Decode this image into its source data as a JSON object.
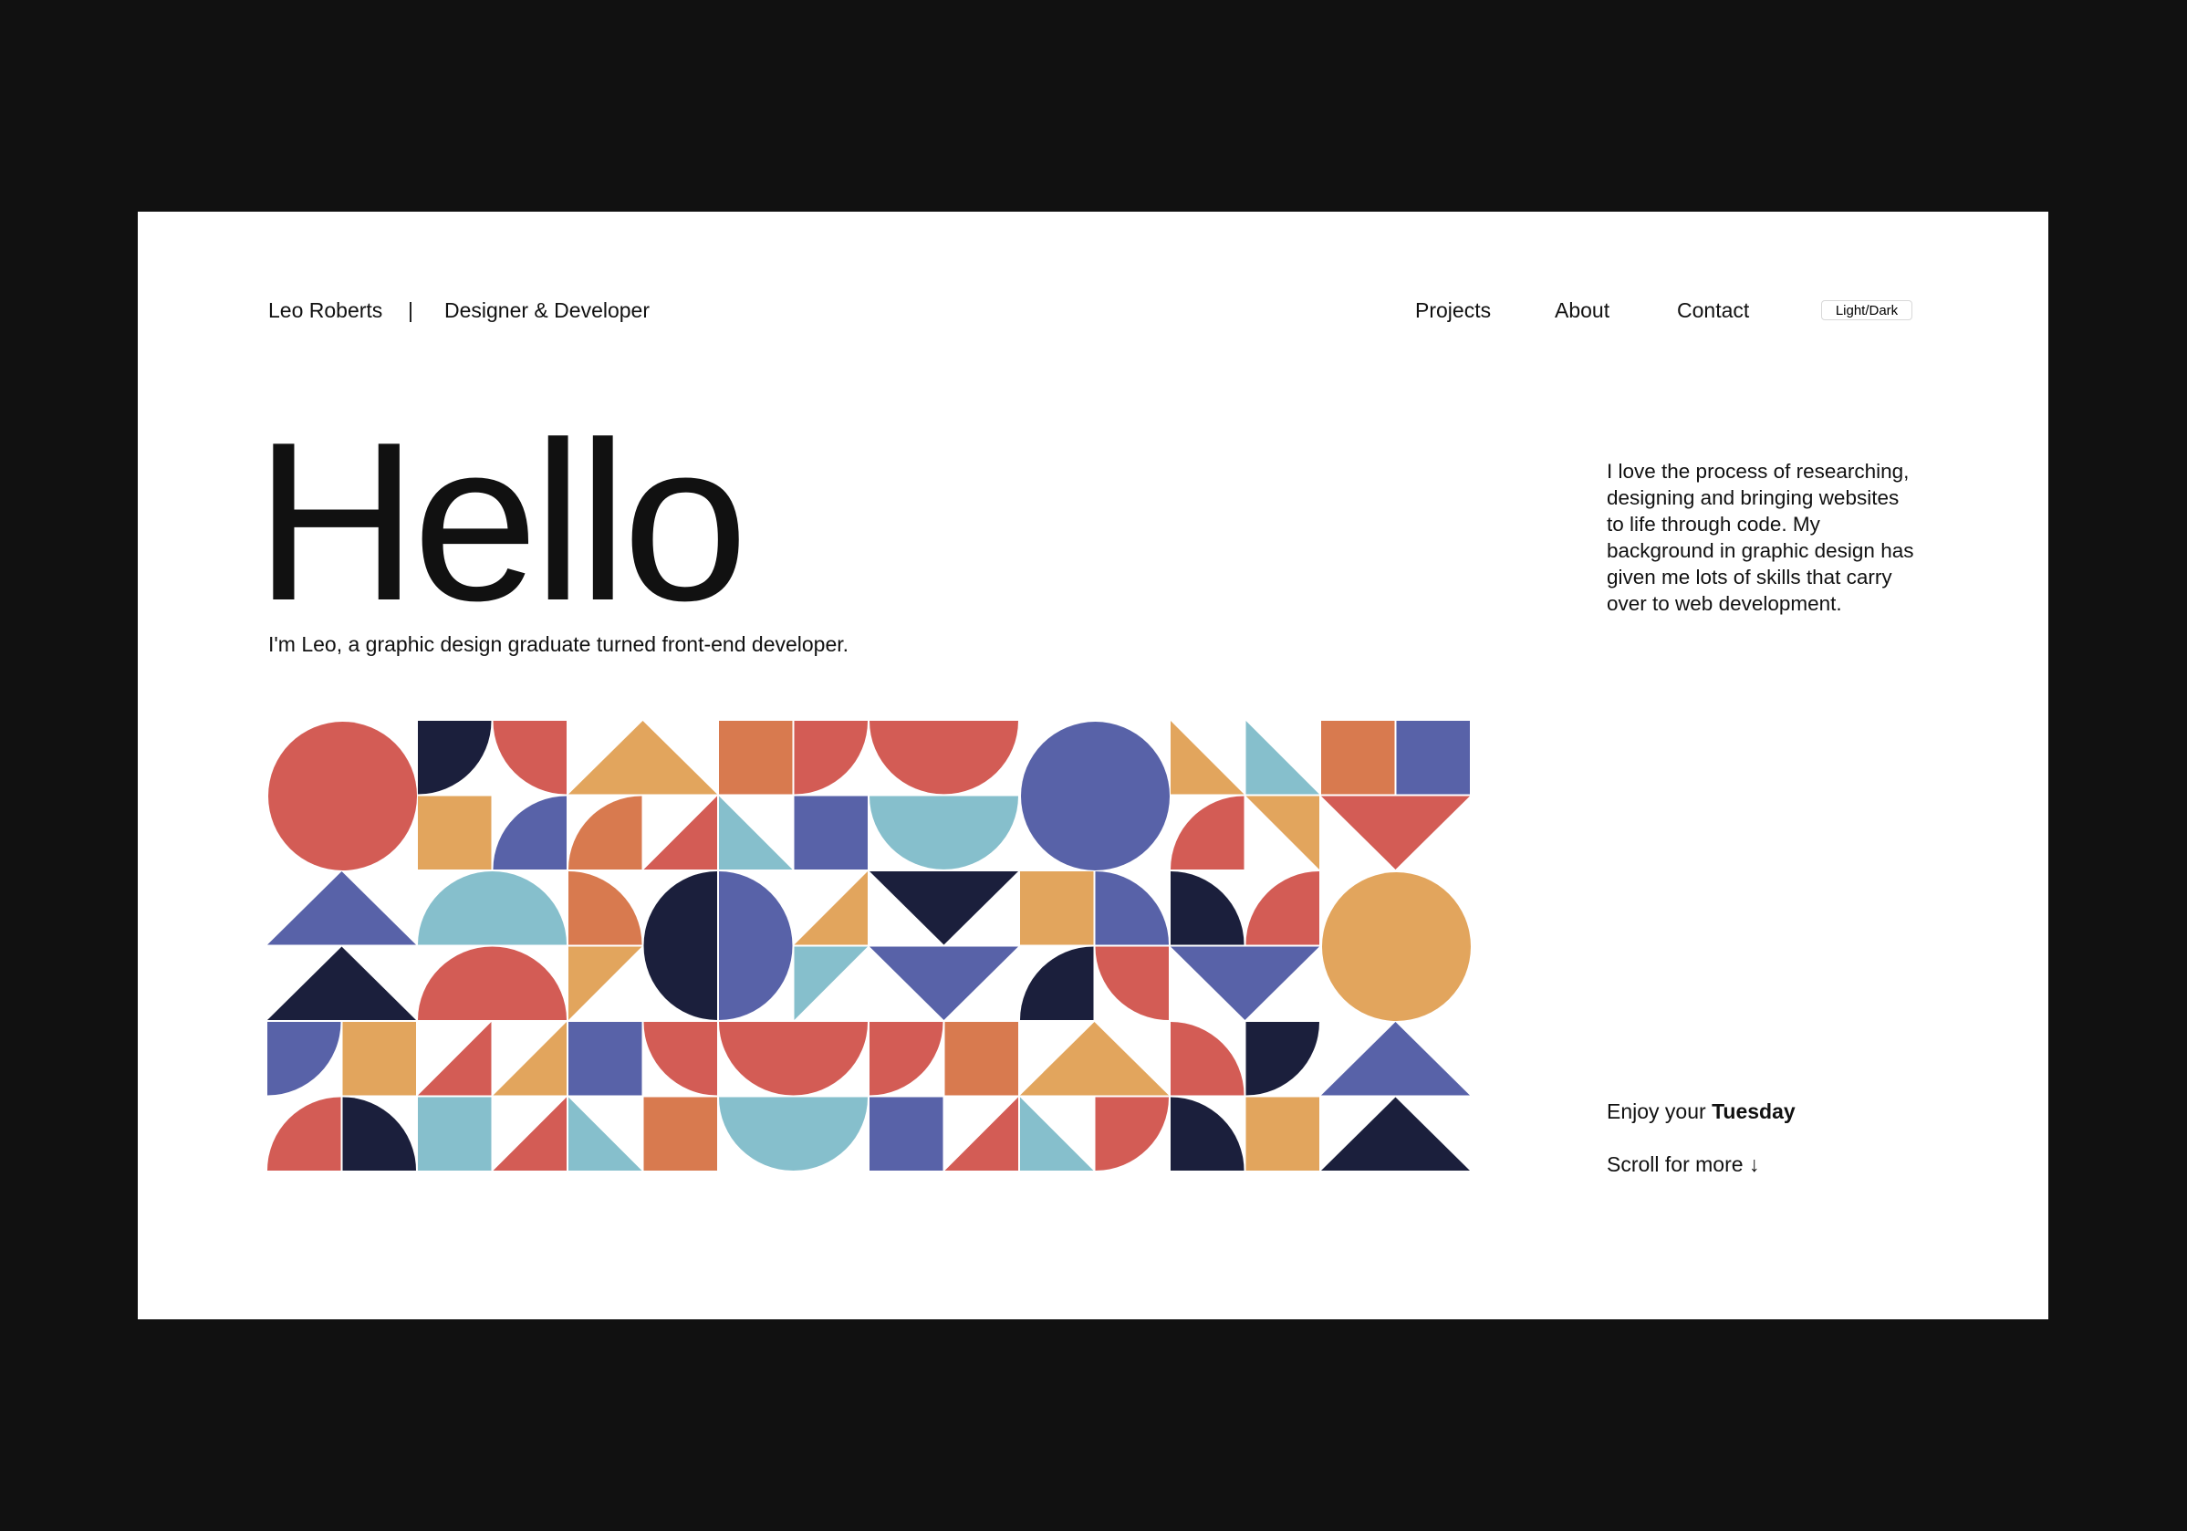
{
  "header": {
    "name": "Leo Roberts",
    "separator": "|",
    "role": "Designer & Developer",
    "nav": [
      "Projects",
      "About",
      "Contact"
    ],
    "theme_toggle": "Light/Dark"
  },
  "hero": {
    "title": "Hello",
    "subtitle": "I'm Leo, a graphic design graduate turned front-end developer."
  },
  "intro": "I love the process of researching, designing and bringing websites to life through code. My background in graphic design has given me lots of skills that carry over to web development.",
  "greeting": {
    "prefix": "Enjoy your",
    "day": "Tuesday"
  },
  "scroll": "Scroll for more ↓",
  "colors": {
    "background": "#111111",
    "page": "#ffffff",
    "red": "#d35c55",
    "orange": "#d87a4f",
    "yellow": "#e2a55d",
    "blue": "#5862a8",
    "teal": "#86bfcc",
    "navy": "#1b1f3c"
  },
  "pattern": {
    "shapes": [
      {
        "t": "circle",
        "c": 0,
        "r": 0,
        "s": 2,
        "fill": "red"
      },
      {
        "t": "q",
        "c": 2,
        "r": 0,
        "o": "tl",
        "fill": "navy"
      },
      {
        "t": "q",
        "c": 3,
        "r": 0,
        "o": "tr",
        "fill": "red"
      },
      {
        "t": "tri",
        "c": 4,
        "r": 0,
        "w": 2,
        "o": "up",
        "fill": "yellow"
      },
      {
        "t": "sq",
        "c": 6,
        "r": 0,
        "fill": "orange"
      },
      {
        "t": "q",
        "c": 7,
        "r": 0,
        "o": "tl",
        "fill": "red"
      },
      {
        "t": "semi",
        "c": 8,
        "r": 0,
        "o": "down",
        "fill": "red"
      },
      {
        "t": "circle",
        "c": 10,
        "r": 0,
        "s": 2,
        "fill": "blue"
      },
      {
        "t": "rt",
        "c": 12,
        "r": 0,
        "o": "bl",
        "fill": "yellow"
      },
      {
        "t": "rt",
        "c": 13,
        "r": 0,
        "o": "bl",
        "fill": "teal"
      },
      {
        "t": "sq",
        "c": 14,
        "r": 0,
        "fill": "orange"
      },
      {
        "t": "sq",
        "c": 15,
        "r": 0,
        "fill": "blue"
      },
      {
        "t": "sq",
        "c": 2,
        "r": 1,
        "fill": "yellow"
      },
      {
        "t": "q",
        "c": 3,
        "r": 1,
        "o": "br",
        "fill": "blue"
      },
      {
        "t": "q",
        "c": 4,
        "r": 1,
        "o": "br",
        "fill": "orange"
      },
      {
        "t": "rt",
        "c": 5,
        "r": 1,
        "o": "br",
        "fill": "red"
      },
      {
        "t": "rt",
        "c": 6,
        "r": 1,
        "o": "bl",
        "fill": "teal"
      },
      {
        "t": "sq",
        "c": 7,
        "r": 1,
        "fill": "blue"
      },
      {
        "t": "semi",
        "c": 8,
        "r": 1,
        "o": "down",
        "fill": "teal"
      },
      {
        "t": "q",
        "c": 12,
        "r": 1,
        "o": "br",
        "fill": "red"
      },
      {
        "t": "rt",
        "c": 13,
        "r": 1,
        "o": "tr",
        "fill": "yellow"
      },
      {
        "t": "tri",
        "c": 14,
        "r": 1,
        "w": 2,
        "o": "down",
        "fill": "red"
      },
      {
        "t": "tri",
        "c": 0,
        "r": 2,
        "w": 2,
        "o": "up",
        "fill": "blue"
      },
      {
        "t": "semi",
        "c": 2,
        "r": 2,
        "o": "up",
        "fill": "teal"
      },
      {
        "t": "q",
        "c": 4,
        "r": 2,
        "o": "bl",
        "fill": "orange"
      },
      {
        "t": "hc",
        "c": 5,
        "r": 2,
        "o": "left",
        "fill": "navy"
      },
      {
        "t": "hc",
        "c": 6,
        "r": 2,
        "o": "right",
        "fill": "blue"
      },
      {
        "t": "rt",
        "c": 7,
        "r": 2,
        "o": "br",
        "fill": "yellow"
      },
      {
        "t": "tri",
        "c": 8,
        "r": 2,
        "w": 2,
        "o": "down",
        "fill": "navy"
      },
      {
        "t": "sq",
        "c": 10,
        "r": 2,
        "fill": "yellow"
      },
      {
        "t": "q",
        "c": 11,
        "r": 2,
        "o": "bl",
        "fill": "blue"
      },
      {
        "t": "q",
        "c": 12,
        "r": 2,
        "o": "bl",
        "fill": "navy"
      },
      {
        "t": "q",
        "c": 13,
        "r": 2,
        "o": "br",
        "fill": "red"
      },
      {
        "t": "circle",
        "c": 14,
        "r": 2,
        "s": 2,
        "fill": "yellow"
      },
      {
        "t": "tri",
        "c": 0,
        "r": 3,
        "w": 2,
        "o": "up",
        "fill": "navy"
      },
      {
        "t": "semi",
        "c": 2,
        "r": 3,
        "o": "up",
        "fill": "red"
      },
      {
        "t": "rt",
        "c": 4,
        "r": 3,
        "o": "tl",
        "fill": "yellow"
      },
      {
        "t": "rt",
        "c": 7,
        "r": 3,
        "o": "tl",
        "fill": "teal"
      },
      {
        "t": "tri",
        "c": 8,
        "r": 3,
        "w": 2,
        "o": "down",
        "fill": "blue"
      },
      {
        "t": "q",
        "c": 10,
        "r": 3,
        "o": "br",
        "fill": "navy"
      },
      {
        "t": "q",
        "c": 11,
        "r": 3,
        "o": "tr",
        "fill": "red"
      },
      {
        "t": "tri",
        "c": 12,
        "r": 3,
        "w": 2,
        "o": "down",
        "fill": "blue"
      },
      {
        "t": "q",
        "c": 0,
        "r": 4,
        "o": "tl",
        "fill": "blue"
      },
      {
        "t": "sq",
        "c": 1,
        "r": 4,
        "fill": "yellow"
      },
      {
        "t": "rt",
        "c": 2,
        "r": 4,
        "o": "br",
        "fill": "red"
      },
      {
        "t": "rt",
        "c": 3,
        "r": 4,
        "o": "br",
        "fill": "yellow"
      },
      {
        "t": "sq",
        "c": 4,
        "r": 4,
        "fill": "blue"
      },
      {
        "t": "q",
        "c": 5,
        "r": 4,
        "o": "tr",
        "fill": "red"
      },
      {
        "t": "semi",
        "c": 6,
        "r": 4,
        "o": "down",
        "fill": "red"
      },
      {
        "t": "q",
        "c": 8,
        "r": 4,
        "o": "tl",
        "fill": "red"
      },
      {
        "t": "sq",
        "c": 9,
        "r": 4,
        "fill": "orange"
      },
      {
        "t": "tri",
        "c": 10,
        "r": 4,
        "w": 2,
        "o": "up",
        "fill": "yellow"
      },
      {
        "t": "q",
        "c": 12,
        "r": 4,
        "o": "bl",
        "fill": "red"
      },
      {
        "t": "q",
        "c": 13,
        "r": 4,
        "o": "tl",
        "fill": "navy"
      },
      {
        "t": "tri",
        "c": 14,
        "r": 4,
        "w": 2,
        "o": "up",
        "fill": "blue"
      },
      {
        "t": "q",
        "c": 0,
        "r": 5,
        "o": "br",
        "fill": "red"
      },
      {
        "t": "q",
        "c": 1,
        "r": 5,
        "o": "bl",
        "fill": "navy"
      },
      {
        "t": "sq",
        "c": 2,
        "r": 5,
        "fill": "teal"
      },
      {
        "t": "rt",
        "c": 3,
        "r": 5,
        "o": "br",
        "fill": "red"
      },
      {
        "t": "rt",
        "c": 4,
        "r": 5,
        "o": "bl",
        "fill": "teal"
      },
      {
        "t": "sq",
        "c": 5,
        "r": 5,
        "fill": "orange"
      },
      {
        "t": "semi",
        "c": 6,
        "r": 5,
        "o": "down",
        "fill": "teal"
      },
      {
        "t": "sq",
        "c": 8,
        "r": 5,
        "fill": "blue"
      },
      {
        "t": "rt",
        "c": 9,
        "r": 5,
        "o": "br",
        "fill": "red"
      },
      {
        "t": "rt",
        "c": 10,
        "r": 5,
        "o": "bl",
        "fill": "teal"
      },
      {
        "t": "q",
        "c": 11,
        "r": 5,
        "o": "tl",
        "fill": "red"
      },
      {
        "t": "q",
        "c": 12,
        "r": 5,
        "o": "bl",
        "fill": "navy"
      },
      {
        "t": "sq",
        "c": 13,
        "r": 5,
        "fill": "yellow"
      },
      {
        "t": "tri",
        "c": 14,
        "r": 5,
        "w": 2,
        "o": "up",
        "fill": "navy"
      }
    ]
  }
}
